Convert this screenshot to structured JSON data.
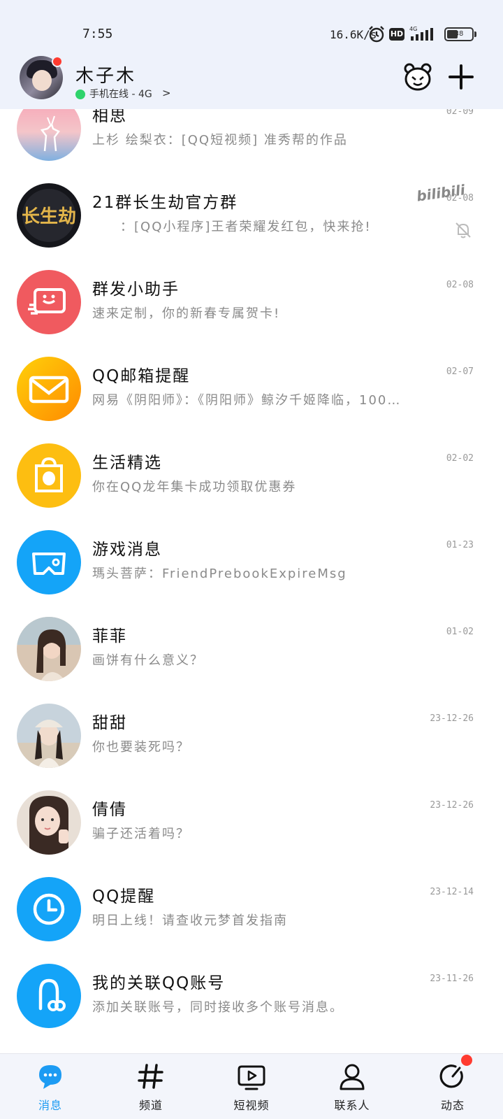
{
  "status_bar": {
    "time": "7:55",
    "net_speed": "16.6K/s",
    "hd_label": "HD",
    "signal_label": "4G",
    "battery": "38"
  },
  "header": {
    "profile_name": "木子木",
    "online_status": "手机在线 - 4G",
    "bear_icon": "qq-bear-icon",
    "add_icon": "plus-icon"
  },
  "conversations": [
    {
      "title": "相思",
      "preview": "上杉 绘梨衣：[QQ短视频] 准秀帮的作品",
      "time": "02-09",
      "avatar": "deer-sunset-avatar"
    },
    {
      "title": "21群长生劫官方群",
      "preview": "：[QQ小程序]王者荣耀发红包，快来抢!",
      "time": "02-08",
      "avatar": "changshengjie-avatar",
      "tag": "bilibili",
      "muted": true
    },
    {
      "title": "群发小助手",
      "preview": "速来定制，你的新春专属贺卡!",
      "time": "02-08",
      "avatar": "group-send-icon",
      "color": "#f05a5f"
    },
    {
      "title": "QQ邮箱提醒",
      "preview": "网易《阴阳师》：《阴阳师》鲸汐千姬降临，100…",
      "time": "02-07",
      "avatar": "mail-icon",
      "color": "#fdbb12"
    },
    {
      "title": "生活精选",
      "preview": "你在QQ龙年集卡成功领取优惠券",
      "time": "02-02",
      "avatar": "shopping-bag-icon",
      "color": "#fdbe11"
    },
    {
      "title": "游戏消息",
      "preview": "瑪头菩萨：FriendPrebookExpireMsg",
      "time": "01-23",
      "avatar": "game-icon",
      "color": "#14a4f8"
    },
    {
      "title": "菲菲",
      "preview": "画饼有什么意义？",
      "time": "01-02",
      "avatar": "girl-photo-avatar"
    },
    {
      "title": "甜甜",
      "preview": "你也要装死吗？",
      "time": "23-12-26",
      "avatar": "girl-hat-avatar"
    },
    {
      "title": "倩倩",
      "preview": "骗子还活着吗？",
      "time": "23-12-26",
      "avatar": "girl-selfie-avatar"
    },
    {
      "title": "QQ提醒",
      "preview": "明日上线！请查收元梦首发指南",
      "time": "23-12-14",
      "avatar": "clock-icon",
      "color": "#14a4f8"
    },
    {
      "title": "我的关联QQ账号",
      "preview": "添加关联账号，同时接收多个账号消息。",
      "time": "23-11-26",
      "avatar": "linked-account-icon",
      "color": "#14a4f8"
    }
  ],
  "bilibili_tag": "bilibili",
  "nav": [
    {
      "label": "消息",
      "icon": "message-icon",
      "active": true
    },
    {
      "label": "频道",
      "icon": "hashtag-icon"
    },
    {
      "label": "短视频",
      "icon": "video-icon"
    },
    {
      "label": "联系人",
      "icon": "contact-icon"
    },
    {
      "label": "动态",
      "icon": "activity-icon"
    }
  ],
  "colors": {
    "accent": "#1c9bf3",
    "header_bg": "#eef2fb",
    "badge_red": "#ff3b30",
    "online_green": "#2ed36b"
  }
}
